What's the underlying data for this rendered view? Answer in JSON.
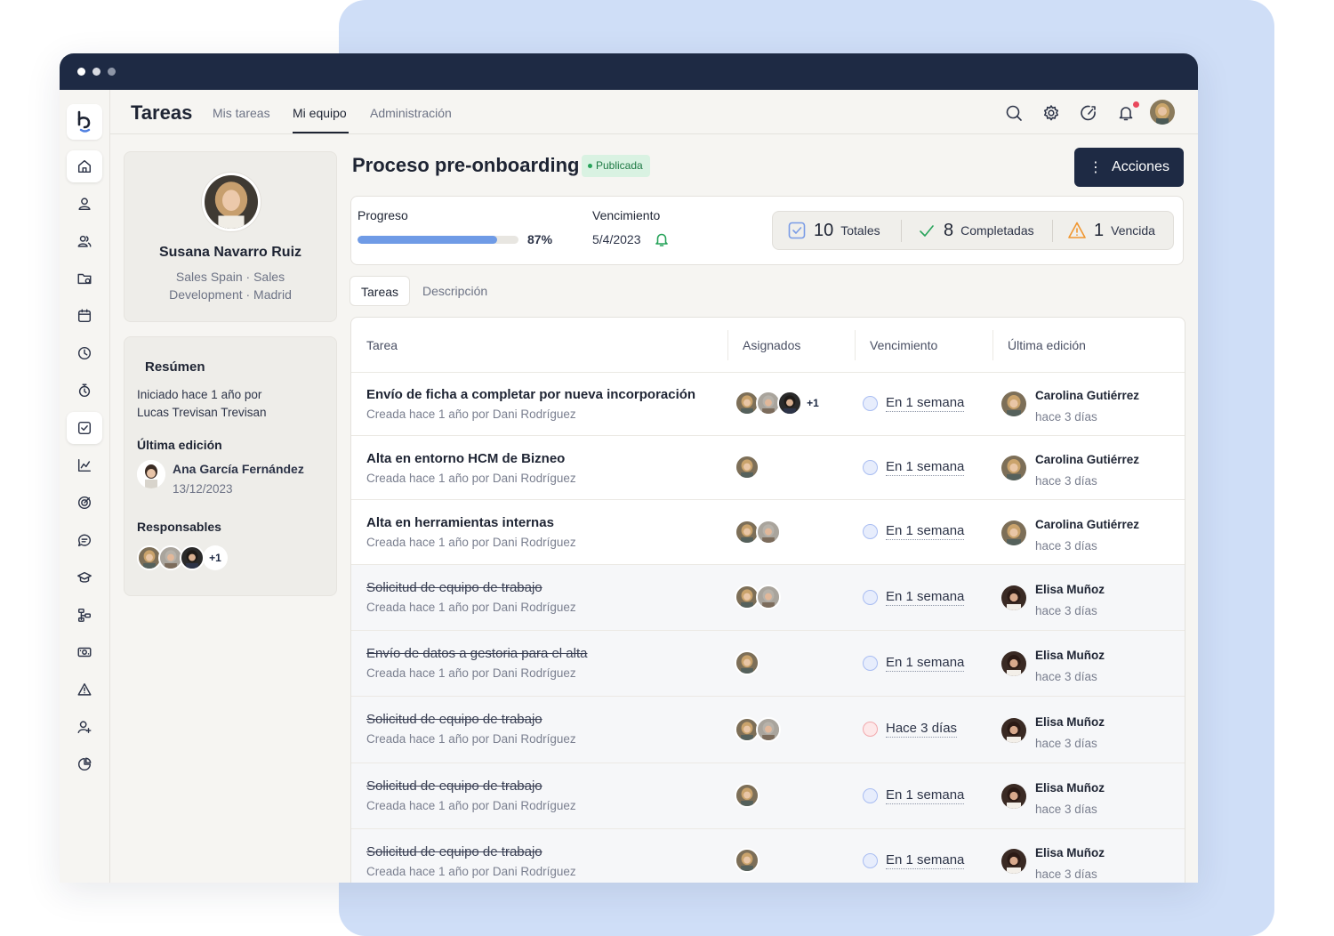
{
  "app": {
    "title": "Tareas"
  },
  "nav": {
    "tabs": [
      "Mis tareas",
      "Mi equipo",
      "Administración"
    ],
    "active": "Mi equipo"
  },
  "header_icons": [
    "search-icon",
    "settings-icon",
    "speed-icon",
    "bell-icon",
    "avatar"
  ],
  "sidebar_icons": [
    "home-icon",
    "user-icon",
    "users-icon",
    "folder-icon",
    "calendar-icon",
    "clock-icon",
    "timer-icon",
    "checkbox-icon",
    "chart-icon",
    "target-icon",
    "chat-icon",
    "graduation-icon",
    "flow-icon",
    "money-icon",
    "alert-icon",
    "user-plus-icon",
    "pie-icon"
  ],
  "profile": {
    "name": "Susana Navarro Ruiz",
    "subtitle": "Sales Spain · Sales Development · Madrid"
  },
  "summary": {
    "title": "Resúmen",
    "started": "Iniciado hace 1 año por Lucas Trevisan Trevisan",
    "last_edit_label": "Última edición",
    "last_editor": "Ana García Fernández",
    "last_edit_date": "13/12/2023",
    "responsables_label": "Responsables",
    "responsables_more": "+1"
  },
  "process": {
    "title": "Proceso pre-onboarding",
    "status": "Publicada",
    "actions_label": "Acciones"
  },
  "stats": {
    "progress_label": "Progreso",
    "progress_percent": "87%",
    "progress_fraction": 0.87,
    "due_label": "Vencimiento",
    "due_date": "5/4/2023",
    "total": "10",
    "total_label": "Totales",
    "completed": "8",
    "completed_label": "Completadas",
    "overdue": "1",
    "overdue_label": "Vencida"
  },
  "sub_tabs": [
    "Tareas",
    "Descripción"
  ],
  "table": {
    "headers": [
      "Tarea",
      "Asignados",
      "Vencimiento",
      "Última edición"
    ],
    "rows": [
      {
        "title": "Envío de ficha a completar por nueva incorporación",
        "sub": "Creada hace 1 año por Dani Rodríguez",
        "assignees": 3,
        "more": "+1",
        "due": "En 1 semana",
        "late": false,
        "editor": "Carolina Gutiérrez",
        "edited": "hace 3 días",
        "done": false
      },
      {
        "title": "Alta en entorno HCM de Bizneo",
        "sub": "Creada hace 1 año por Dani Rodríguez",
        "assignees": 1,
        "more": "",
        "due": "En 1 semana",
        "late": false,
        "editor": "Carolina Gutiérrez",
        "edited": "hace 3 días",
        "done": false
      },
      {
        "title": "Alta en herramientas internas",
        "sub": "Creada hace 1 año por Dani Rodríguez",
        "assignees": 2,
        "more": "",
        "due": "En 1 semana",
        "late": false,
        "editor": "Carolina Gutiérrez",
        "edited": "hace 3 días",
        "done": false
      },
      {
        "title": "Solicitud de equipo de trabajo",
        "sub": "Creada hace 1 año por Dani Rodríguez",
        "assignees": 2,
        "more": "",
        "due": "En 1 semana",
        "late": false,
        "editor": "Elisa Muñoz",
        "edited": "hace 3 días",
        "done": true
      },
      {
        "title": "Envío de datos a gestoria para el alta",
        "sub": "Creada hace 1 año por Dani Rodríguez",
        "assignees": 1,
        "more": "",
        "due": "En 1 semana",
        "late": false,
        "editor": "Elisa Muñoz",
        "edited": "hace 3 días",
        "done": true
      },
      {
        "title": "Solicitud de equipo de trabajo",
        "sub": "Creada hace 1 año por Dani Rodríguez",
        "assignees": 2,
        "more": "",
        "due": "Hace 3 días",
        "late": true,
        "editor": "Elisa Muñoz",
        "edited": "hace 3 días",
        "done": true
      },
      {
        "title": "Solicitud de equipo de trabajo",
        "sub": "Creada hace 1 año por Dani Rodríguez",
        "assignees": 1,
        "more": "",
        "due": "En 1 semana",
        "late": false,
        "editor": "Elisa Muñoz",
        "edited": "hace 3 días",
        "done": true
      },
      {
        "title": "Solicitud de equipo de trabajo",
        "sub": "Creada hace 1 año por Dani Rodríguez",
        "assignees": 1,
        "more": "",
        "due": "En 1 semana",
        "late": false,
        "editor": "Elisa Muñoz",
        "edited": "hace 3 días",
        "done": true
      }
    ]
  }
}
